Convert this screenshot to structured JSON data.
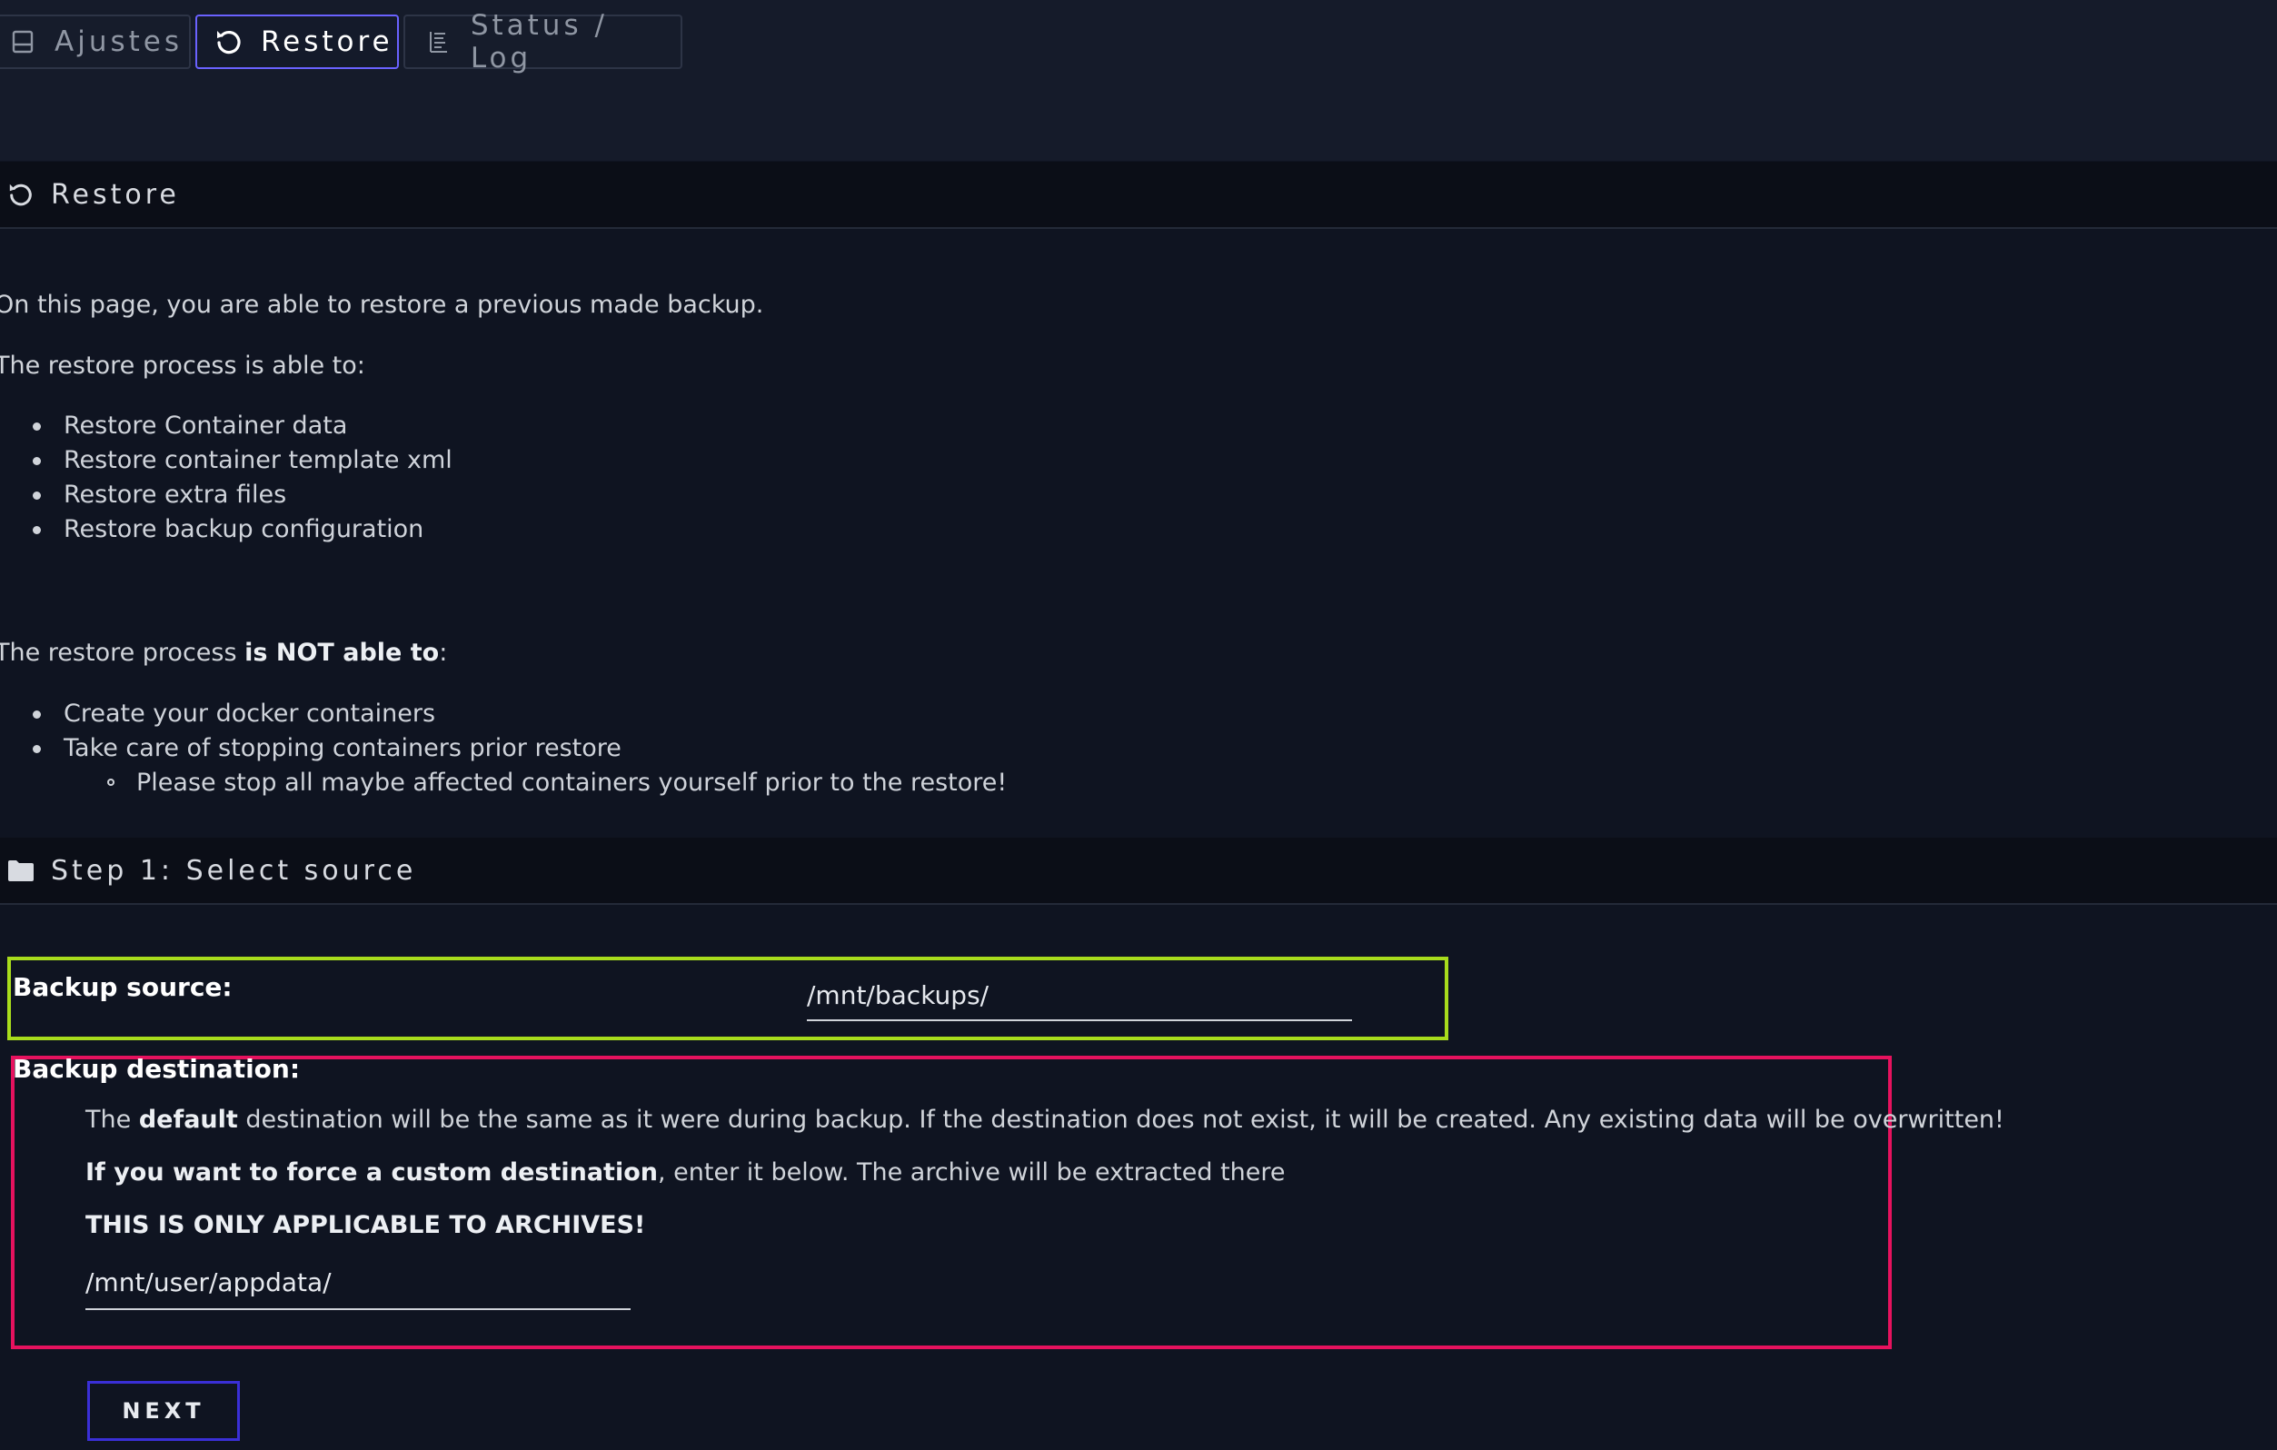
{
  "tabs": [
    {
      "label": "Ajustes",
      "icon": "drive-icon",
      "active": false
    },
    {
      "label": "Restore",
      "icon": "restore-icon",
      "active": true
    },
    {
      "label": "Status / Log",
      "icon": "list-icon",
      "active": false
    }
  ],
  "restore_section": {
    "title": "Restore",
    "intro": "On this page, you are able to restore a previous made backup.",
    "able_intro": "The restore process is able to:",
    "able_items": [
      "Restore Container data",
      "Restore container template xml",
      "Restore extra files",
      "Restore backup configuration"
    ],
    "not_able_prefix": "The restore process ",
    "not_able_bold": "is NOT able to",
    "not_able_suffix": ":",
    "not_able_items": [
      "Create your docker containers",
      "Take care of stopping containers prior restore"
    ],
    "not_able_subitem": "Please stop all maybe affected containers yourself prior to the restore!"
  },
  "step1": {
    "title": "Step 1: Select source",
    "backup_source_label": "Backup source:",
    "backup_source_value": "/mnt/backups/",
    "backup_destination_label": "Backup destination:",
    "dest_line1_prefix": "The ",
    "dest_line1_bold": "default",
    "dest_line1_suffix": " destination will be the same as it were during backup. If the destination does not exist, it will be created. Any existing data will be overwritten!",
    "dest_line2_bold": "If you want to force a custom destination",
    "dest_line2_suffix": ", enter it below. The archive will be extracted there",
    "dest_line3": "THIS IS ONLY APPLICABLE TO ARCHIVES!",
    "backup_destination_value": "/mnt/user/appdata/",
    "next_label": "NEXT"
  },
  "colors": {
    "source_highlight": "#a8dc1c",
    "destination_highlight": "#e6125e",
    "next_border": "#3a2fd6",
    "active_tab_border": "#6a62ff"
  }
}
